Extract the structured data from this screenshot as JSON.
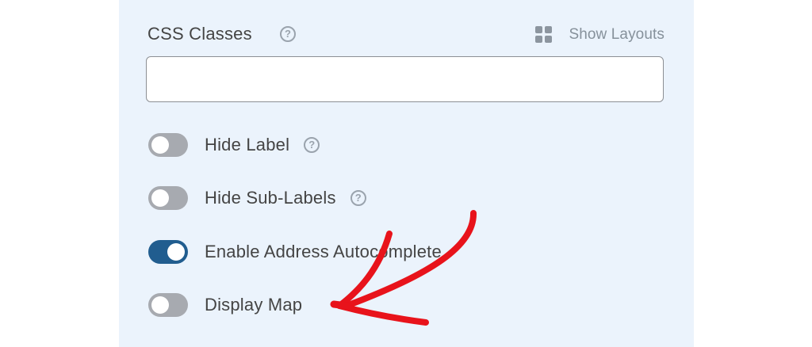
{
  "field": {
    "title": "CSS Classes",
    "help_icon": "question-circle-icon",
    "show_layouts_label": "Show Layouts",
    "show_layouts_icon": "grid-icon",
    "input_value": "",
    "input_placeholder": ""
  },
  "options": [
    {
      "label": "Hide Label",
      "enabled": false,
      "has_help": true
    },
    {
      "label": "Hide Sub-Labels",
      "enabled": false,
      "has_help": true
    },
    {
      "label": "Enable Address Autocomplete",
      "enabled": true,
      "has_help": false
    },
    {
      "label": "Display Map",
      "enabled": false,
      "has_help": false
    }
  ],
  "colors": {
    "panel_background": "#ebf3fc",
    "toggle_on": "#215d8f",
    "toggle_off": "#a7aab0",
    "annotation_arrow": "#e8131b"
  },
  "annotation": {
    "icon": "red-arrow-icon"
  }
}
